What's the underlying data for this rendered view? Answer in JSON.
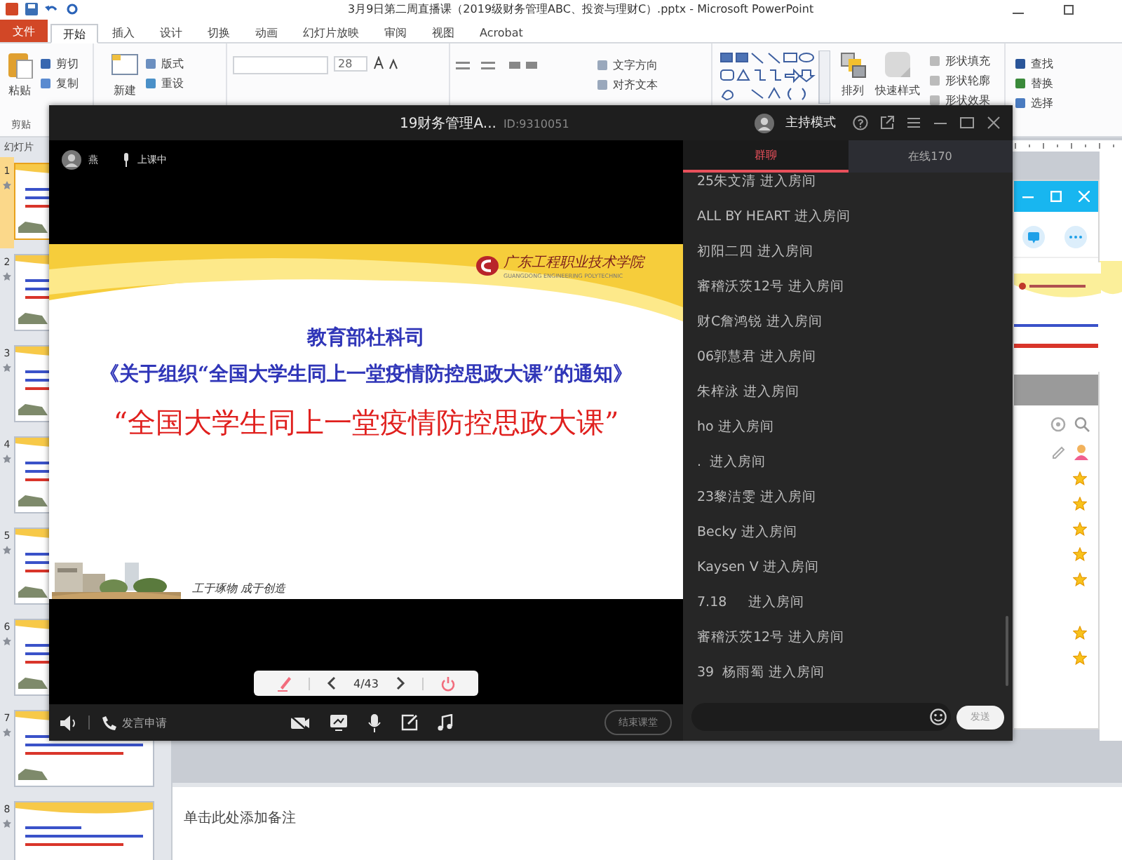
{
  "powerpoint": {
    "title": "3月9日第二周直播课（2019级财务管理ABC、投资与理财C）.pptx - Microsoft PowerPoint",
    "tabs": [
      {
        "label": "文件",
        "kind": "file",
        "selected": false
      },
      {
        "label": "开始",
        "kind": "tab",
        "selected": true
      },
      {
        "label": "插入",
        "kind": "tab",
        "selected": false
      },
      {
        "label": "设计",
        "kind": "tab",
        "selected": false
      },
      {
        "label": "切换",
        "kind": "tab",
        "selected": false
      },
      {
        "label": "动画",
        "kind": "tab",
        "selected": false
      },
      {
        "label": "幻灯片放映",
        "kind": "tab",
        "selected": false
      },
      {
        "label": "审阅",
        "kind": "tab",
        "selected": false
      },
      {
        "label": "视图",
        "kind": "tab",
        "selected": false
      },
      {
        "label": "Acrobat",
        "kind": "tab",
        "selected": false
      }
    ],
    "ribbon": [
      {
        "kind": "clipboard",
        "items": [
          "粘贴",
          "剪切",
          "复制"
        ],
        "caption": "剪贴"
      },
      {
        "kind": "slides",
        "items": [
          "新建",
          "版式",
          "重设"
        ]
      },
      {
        "kind": "font",
        "items": [
          "28"
        ]
      },
      {
        "kind": "paragraph",
        "items": [
          "文字方向",
          "对齐文本"
        ]
      },
      {
        "kind": "drawing",
        "items": [
          "排列",
          "快速样式",
          "形状填充",
          "形状轮廓",
          "形状效果"
        ]
      },
      {
        "kind": "editing",
        "items": [
          "查找",
          "替换",
          "选择"
        ]
      }
    ],
    "slides_tab": "幻灯片",
    "thumbnails": [
      {
        "number": "1",
        "selected": true
      },
      {
        "number": "2",
        "selected": false
      },
      {
        "number": "3",
        "selected": false
      },
      {
        "number": "4",
        "selected": false
      },
      {
        "number": "5",
        "selected": false
      },
      {
        "number": "6",
        "selected": false
      },
      {
        "number": "7",
        "selected": false
      },
      {
        "number": "8",
        "selected": false
      }
    ],
    "notes_placeholder": "单击此处添加备注"
  },
  "live_class": {
    "title": "19财务管理A...",
    "room_id": "ID:9310051",
    "mode": "主持模式",
    "teacher": "燕",
    "status": "上课中",
    "slide": {
      "school": "广东工程职业技术学院",
      "school_en": "GUANGDONG ENGINEERING POLYTECHNIC",
      "lines": [
        {
          "kind": "heading",
          "text": "教育部社科司"
        },
        {
          "kind": "subtitle",
          "text": "《关于组织“全国大学生同上一堂疫情防控思政大课”的通知》"
        },
        {
          "kind": "title",
          "text": "“全国大学生同上一堂疫情防控思政大课”"
        }
      ],
      "motto": "工于琢物 成于创造"
    },
    "pager": "4/43",
    "request_speak": "发言申请",
    "end_class": "结束课堂"
  },
  "chat": {
    "tabs": [
      {
        "label": "群聊",
        "selected": true
      },
      {
        "label": "在线170",
        "selected": false
      }
    ],
    "messages": [
      "25朱文清 进入房间",
      "ALL BY HEART 进入房间",
      "初阳二四 进入房间",
      "審稽沃茨12号 进入房间",
      "财C詹鸿锐 进入房间",
      "06郭慧君 进入房间",
      "朱梓泳 进入房间",
      "ho 进入房间",
      ".  进入房间",
      "23黎洁雯 进入房间",
      "Becky 进入房间",
      "Kaysen V 进入房间",
      "7.18     进入房间",
      "審稽沃茨12号 进入房间",
      "39  杨雨蜀 进入房间"
    ],
    "send": "发送"
  }
}
